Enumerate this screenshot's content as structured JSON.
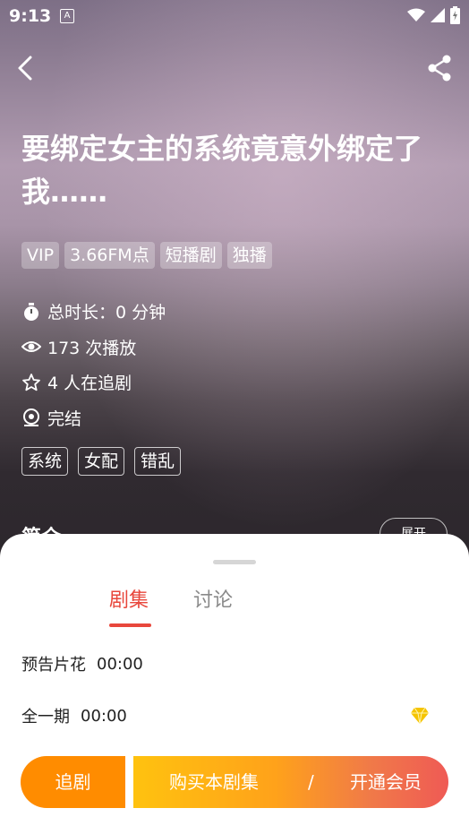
{
  "status_bar": {
    "time": "9:13",
    "badge": "A"
  },
  "header": {
    "back_icon": "back-arrow-icon",
    "share_icon": "share-icon"
  },
  "show": {
    "title": "要绑定女主的系统竟意外绑定了我……",
    "badges": [
      "VIP",
      "3.66FM点",
      "短播剧",
      "独播"
    ],
    "meta": {
      "duration": "总时长：0 分钟",
      "plays": "173 次播放",
      "followers": "4 人在追剧",
      "status": "完结"
    },
    "tags": [
      "系统",
      "女配",
      "错乱"
    ],
    "intro_label": "简介",
    "expand_label": "展开"
  },
  "sheet": {
    "tabs": [
      {
        "label": "剧集",
        "active": true
      },
      {
        "label": "讨论",
        "active": false
      }
    ],
    "episodes": [
      {
        "name": "预告片花",
        "time": "00:00",
        "vip": false
      },
      {
        "name": "全一期",
        "time": "00:00",
        "vip": true
      }
    ],
    "actions": {
      "follow": "追剧",
      "buy": "购买本剧集",
      "separator": "/",
      "vip": "开通会员"
    }
  },
  "colors": {
    "accent": "#e8473c",
    "follow": "#ff8c00",
    "vip_gold": "#f5c400"
  }
}
